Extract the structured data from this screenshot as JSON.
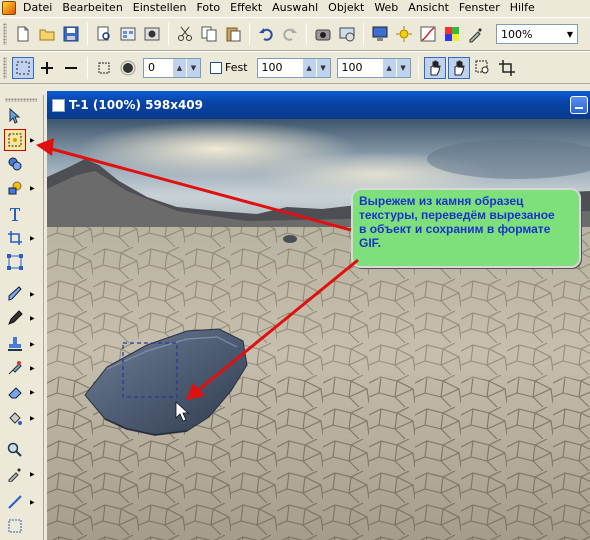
{
  "menu": [
    "Datei",
    "Bearbeiten",
    "Einstellen",
    "Foto",
    "Effekt",
    "Auswahl",
    "Objekt",
    "Web",
    "Ansicht",
    "Fenster",
    "Hilfe"
  ],
  "toolbar": {
    "zoom_value": "100%"
  },
  "attributes": {
    "size_value": "0",
    "fixed_label": "Fest",
    "width_value": "100",
    "height_value": "100"
  },
  "document": {
    "title": "T-1 (100%) 598x409"
  },
  "callout": {
    "lines": [
      "Вырежем из камня образец",
      "текстуры, переведём вырезаное",
      "в объект и сохраним в формате",
      "GIF."
    ]
  },
  "icons": {
    "toolbox": [
      "pointer-icon",
      "marquee-icon",
      "lasso-icon",
      "shape-icon",
      "text-icon",
      "crop-icon",
      "transform-icon",
      "brush-icon",
      "pen-icon",
      "stamp-icon",
      "retouch-icon",
      "eraser-icon",
      "fill-icon",
      "zoom-icon",
      "eyedropper-icon",
      "line-icon",
      "path-icon"
    ]
  },
  "colors": {
    "callout_bg": "#7ee07a",
    "callout_text": "#1a33cc",
    "arrow": "#e01010",
    "selection_rect": "#2a3f8c"
  }
}
